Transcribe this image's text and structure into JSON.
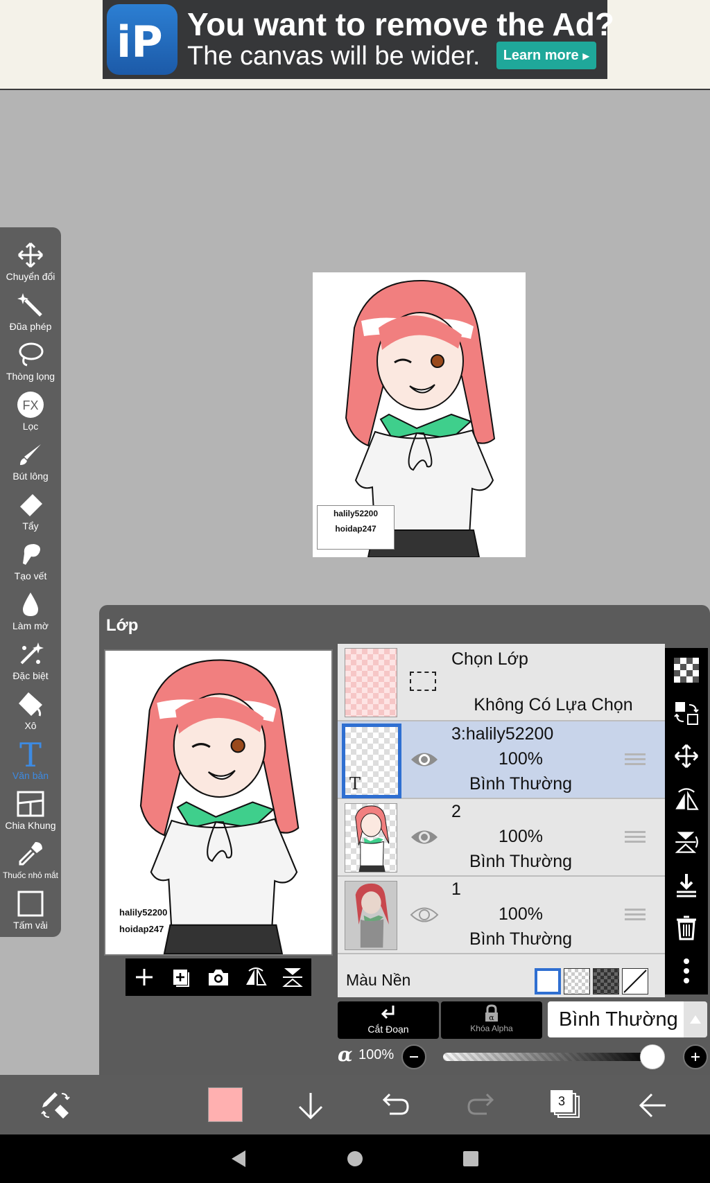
{
  "ad": {
    "logo": "iP",
    "headline": "You want to remove the Ad?",
    "subline": "The canvas will be wider.",
    "cta": "Learn more"
  },
  "watermark": {
    "line1": "halily52200",
    "line2": "hoidap247"
  },
  "toolbar": {
    "items": [
      {
        "label": "Chuyển đổi",
        "icon": "transform-icon"
      },
      {
        "label": "Đũa phép",
        "icon": "magic-wand-icon"
      },
      {
        "label": "Thòng lọng",
        "icon": "lasso-icon"
      },
      {
        "label": "Lọc",
        "icon": "fx-filter-icon"
      },
      {
        "label": "Bút lông",
        "icon": "brush-icon"
      },
      {
        "label": "Tẩy",
        "icon": "eraser-icon"
      },
      {
        "label": "Tạo vết",
        "icon": "smudge-icon"
      },
      {
        "label": "Làm mờ",
        "icon": "blur-drop-icon"
      },
      {
        "label": "Đặc biệt",
        "icon": "special-sparkle-icon"
      },
      {
        "label": "Xô",
        "icon": "bucket-icon"
      },
      {
        "label": "Văn bản",
        "icon": "text-icon"
      },
      {
        "label": "Chia Khung",
        "icon": "frame-divider-icon"
      },
      {
        "label": "Thuốc nhỏ mắt",
        "icon": "eyedropper-icon"
      },
      {
        "label": "Tấm vải",
        "icon": "canvas-icon"
      }
    ],
    "active_index": 10,
    "active_color": "#3d8be3"
  },
  "layer_panel": {
    "title": "Lớp",
    "selection_layer": {
      "title": "Chọn Lớp",
      "status": "Không Có Lựa Chọn"
    },
    "layers": [
      {
        "name": "3:halily52200",
        "opacity": "100%",
        "blend": "Bình Thường",
        "selected": true
      },
      {
        "name": "2",
        "opacity": "100%",
        "blend": "Bình Thường",
        "selected": false
      },
      {
        "name": "1",
        "opacity": "100%",
        "blend": "Bình Thường",
        "selected": false
      }
    ],
    "background_label": "Màu Nền",
    "clipping_label": "Cắt Đoạn",
    "alpha_lock_label": "Khóa Alpha",
    "blend_mode": "Bình Thường",
    "opacity_label": "100%",
    "opacity_value": 1.0
  },
  "bottom": {
    "layer_count": "3",
    "primary_color": "#ffb0b0"
  },
  "colors": {
    "accent_blue": "#2f6fd1",
    "selected_row": "#c8d4ea",
    "panel_gray": "#5b5b5b"
  }
}
